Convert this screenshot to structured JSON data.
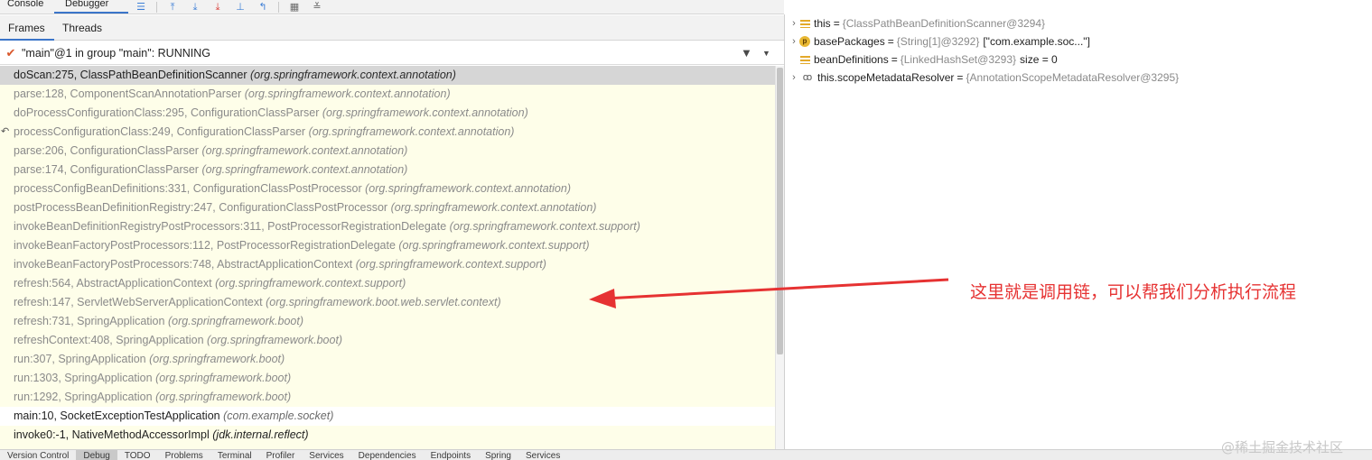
{
  "toolbar": {
    "tabs": [
      "Console",
      "Debugger"
    ],
    "icons": [
      "menu-lines-icon",
      "show-execution-point-icon",
      "step-over-icon",
      "step-into-icon",
      "force-step-into-icon",
      "step-out-icon",
      "run-to-cursor-icon",
      "evaluate-expression-icon",
      "table-icon",
      "settings-icon"
    ]
  },
  "subtabs": [
    "Frames",
    "Threads"
  ],
  "thread": {
    "label": "\"main\"@1 in group \"main\": RUNNING"
  },
  "frames": [
    {
      "method": "doScan:275, ClassPathBeanDefinitionScanner",
      "pkg": "(org.springframework.context.annotation)"
    },
    {
      "method": "parse:128, ComponentScanAnnotationParser",
      "pkg": "(org.springframework.context.annotation)"
    },
    {
      "method": "doProcessConfigurationClass:295, ConfigurationClassParser",
      "pkg": "(org.springframework.context.annotation)"
    },
    {
      "method": "processConfigurationClass:249, ConfigurationClassParser",
      "pkg": "(org.springframework.context.annotation)"
    },
    {
      "method": "parse:206, ConfigurationClassParser",
      "pkg": "(org.springframework.context.annotation)"
    },
    {
      "method": "parse:174, ConfigurationClassParser",
      "pkg": "(org.springframework.context.annotation)"
    },
    {
      "method": "processConfigBeanDefinitions:331, ConfigurationClassPostProcessor",
      "pkg": "(org.springframework.context.annotation)"
    },
    {
      "method": "postProcessBeanDefinitionRegistry:247, ConfigurationClassPostProcessor",
      "pkg": "(org.springframework.context.annotation)"
    },
    {
      "method": "invokeBeanDefinitionRegistryPostProcessors:311, PostProcessorRegistrationDelegate",
      "pkg": "(org.springframework.context.support)"
    },
    {
      "method": "invokeBeanFactoryPostProcessors:112, PostProcessorRegistrationDelegate",
      "pkg": "(org.springframework.context.support)"
    },
    {
      "method": "invokeBeanFactoryPostProcessors:748, AbstractApplicationContext",
      "pkg": "(org.springframework.context.support)"
    },
    {
      "method": "refresh:564, AbstractApplicationContext",
      "pkg": "(org.springframework.context.support)"
    },
    {
      "method": "refresh:147, ServletWebServerApplicationContext",
      "pkg": "(org.springframework.boot.web.servlet.context)"
    },
    {
      "method": "refresh:731, SpringApplication",
      "pkg": "(org.springframework.boot)"
    },
    {
      "method": "refreshContext:408, SpringApplication",
      "pkg": "(org.springframework.boot)"
    },
    {
      "method": "run:307, SpringApplication",
      "pkg": "(org.springframework.boot)"
    },
    {
      "method": "run:1303, SpringApplication",
      "pkg": "(org.springframework.boot)"
    },
    {
      "method": "run:1292, SpringApplication",
      "pkg": "(org.springframework.boot)"
    },
    {
      "method": "main:10, SocketExceptionTestApplication",
      "pkg": "(com.example.socket)"
    },
    {
      "method": "invoke0:-1, NativeMethodAccessorImpl",
      "pkg": "(jdk.internal.reflect)"
    }
  ],
  "variables": [
    {
      "name": "this",
      "value": "{ClassPathBeanDefinitionScanner@3294}",
      "extra": "",
      "icon": "field-icon",
      "expandable": true
    },
    {
      "name": "basePackages",
      "value": "{String[1]@3292}",
      "extra": "[\"com.example.soc...\"]",
      "icon": "parameter-icon",
      "expandable": true
    },
    {
      "name": "beanDefinitions",
      "value": "{LinkedHashSet@3293}",
      "extra": " size = 0",
      "icon": "field-icon",
      "expandable": false
    },
    {
      "name": "this.scopeMetadataResolver",
      "value": "{AnnotationScopeMetadataResolver@3295}",
      "extra": "",
      "icon": "watch-icon",
      "expandable": true
    }
  ],
  "annotation": {
    "text": "这里就是调用链，可以帮我们分析执行流程",
    "color": "#e63232"
  },
  "bottombar": [
    "Version Control",
    "Debug",
    "TODO",
    "Problems",
    "Terminal",
    "Profiler",
    "Services",
    "Dependencies",
    "Endpoints",
    "Spring",
    "Services"
  ],
  "watermark": "@稀土掘金技术社区",
  "colors": {
    "frames_bg": "#fefee9",
    "selected_bg": "#d6d6d6",
    "accent": "#3b75c9"
  }
}
